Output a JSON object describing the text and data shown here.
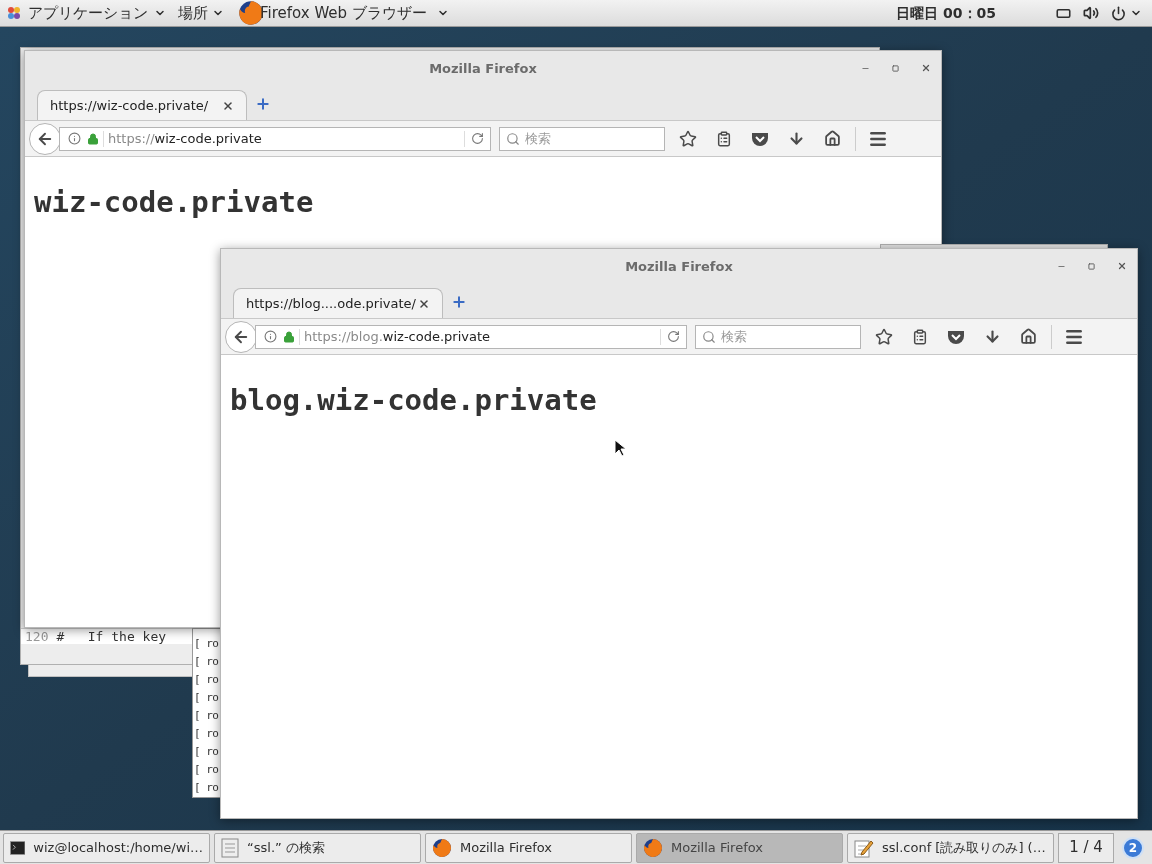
{
  "top_bar": {
    "applications": "アプリケーション",
    "places": "場所",
    "app_name": "Firefox Web ブラウザー",
    "clock": "日曜日 00：05"
  },
  "editor": {
    "line_number": "120",
    "line_text": "#   If the key"
  },
  "terminal": {
    "lines": [
      "[ ro",
      "[ ro",
      "[ ro",
      "[ ro",
      "[ ro",
      "[ ro",
      "[ ro",
      "[ ro",
      "[ ro"
    ]
  },
  "browsers": [
    {
      "title": "Mozilla Firefox",
      "tab_label": "https://wiz-code.private/",
      "url_dim": "https://",
      "url_main": "wiz-code.private",
      "search_placeholder": "検索",
      "heading": "wiz-code.private"
    },
    {
      "title": "Mozilla Firefox",
      "tab_label": "https://blog....ode.private/",
      "url_dim": "https://blog.",
      "url_main": "wiz-code.private",
      "search_placeholder": "検索",
      "heading": "blog.wiz-code.private"
    }
  ],
  "taskbar": {
    "items": [
      {
        "kind": "terminal",
        "label": "wiz@localhost:/home/wi…",
        "selected": false
      },
      {
        "kind": "search",
        "label": "“ssl.” の検索",
        "selected": false
      },
      {
        "kind": "firefox",
        "label": "Mozilla Firefox",
        "selected": false
      },
      {
        "kind": "firefox",
        "label": "Mozilla Firefox",
        "selected": true
      },
      {
        "kind": "editor",
        "label": "ssl.conf [読み取りのみ] (…",
        "selected": false
      }
    ],
    "workspace": "1 / 4",
    "notifications": "2"
  }
}
